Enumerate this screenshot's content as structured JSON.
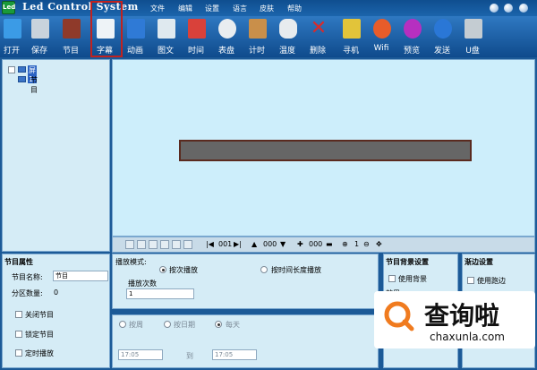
{
  "app": {
    "title": "Led Control System",
    "logo": "Led"
  },
  "menu": [
    "文件",
    "编辑",
    "设置",
    "语言",
    "皮肤",
    "帮助"
  ],
  "toolbar": [
    {
      "name": "open",
      "label": "打开",
      "color": "#3b9be6"
    },
    {
      "name": "save",
      "label": "保存",
      "color": "#c9d3dc"
    },
    {
      "name": "program",
      "label": "节目",
      "color": "#8f3a2a"
    },
    {
      "name": "subtitle",
      "label": "字幕",
      "color": "#eef3f7"
    },
    {
      "name": "animation",
      "label": "动画",
      "color": "#2f7ad6"
    },
    {
      "name": "imagetext",
      "label": "图文",
      "color": "#dfe9ef"
    },
    {
      "name": "time",
      "label": "时间",
      "color": "#d9413a"
    },
    {
      "name": "clock",
      "label": "表盘",
      "color": "#e9edf0"
    },
    {
      "name": "timer",
      "label": "计时",
      "color": "#c98f4a"
    },
    {
      "name": "temperature",
      "label": "温度",
      "color": "#e7ebee"
    },
    {
      "name": "delete",
      "label": "删除",
      "color": "#d92a2a"
    },
    {
      "name": "find",
      "label": "寻机",
      "color": "#e2c43a"
    },
    {
      "name": "wifi",
      "label": "Wifi",
      "color": "#e85c2a"
    },
    {
      "name": "preview",
      "label": "预览",
      "color": "#b62fc0"
    },
    {
      "name": "send",
      "label": "发送",
      "color": "#2a77d6"
    },
    {
      "name": "udisk",
      "label": "U盘",
      "color": "#c4ccd2"
    }
  ],
  "tree": {
    "screen": "屏1",
    "program": "节目"
  },
  "controlbar": {
    "num1": "001",
    "num2": "000",
    "num3": "000",
    "zoom": "1"
  },
  "program_props": {
    "title": "节目属性",
    "name_label": "节目名称:",
    "name_value": "节目",
    "partition_label": "分区数量:",
    "partition_value": "0",
    "close": "关闭节目",
    "lock": "锁定节目",
    "timed": "定时播放"
  },
  "play": {
    "mode_label": "播放模式:",
    "by_count": "按次播放",
    "by_time": "按时间长度播放",
    "count_label": "播放次数",
    "count_value": "1"
  },
  "schedule": {
    "by_week": "按周",
    "by_date": "按日期",
    "every_day": "每天",
    "from": "17:05",
    "to_label": "到",
    "to": "17:05"
  },
  "bg": {
    "title": "节目背景设置",
    "use_bg": "使用背景",
    "effect_label": "效果"
  },
  "border": {
    "title": "渐边设置",
    "use_border": "使用跑边"
  },
  "watermark": {
    "cn": "查询啦",
    "url": "chaxunla.com"
  }
}
